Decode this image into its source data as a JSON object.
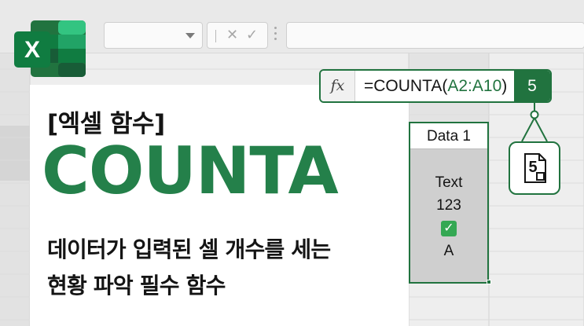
{
  "logo": {
    "letter": "X",
    "brand_color": "#21733f"
  },
  "formula_bar": {
    "icon": "fx-icon",
    "fx_label": "fx",
    "formula_prefix": "=COUNTA(",
    "formula_ref": "A2:A10",
    "formula_suffix": ")",
    "result": "5"
  },
  "title": {
    "subtitle": "[엑셀 함수]",
    "main": "COUNTA",
    "desc_line1": "데이터가 입력된 셀 개수를 세는",
    "desc_line2": "현황 파악 필수 함수"
  },
  "column": {
    "header": "Data 1",
    "cells": [
      "Text",
      "123",
      "",
      "A"
    ],
    "check_icon": "check-mark-icon",
    "check_glyph": "✓"
  },
  "result_card": {
    "value": "5",
    "icon": "document-icon"
  },
  "colors": {
    "accent": "#24804a",
    "dark_green": "#21733f"
  }
}
